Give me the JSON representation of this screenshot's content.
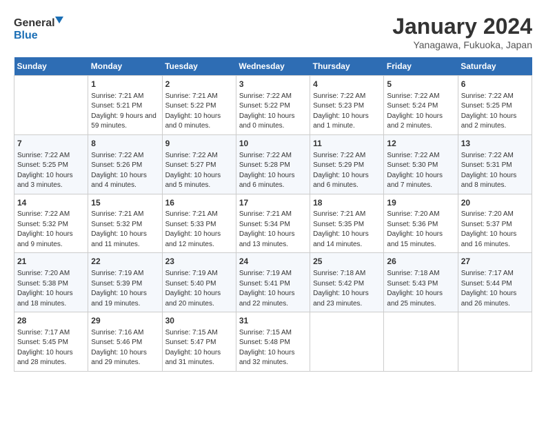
{
  "header": {
    "logo_line1": "General",
    "logo_line2": "Blue",
    "month": "January 2024",
    "location": "Yanagawa, Fukuoka, Japan"
  },
  "days_of_week": [
    "Sunday",
    "Monday",
    "Tuesday",
    "Wednesday",
    "Thursday",
    "Friday",
    "Saturday"
  ],
  "weeks": [
    [
      {
        "day": "",
        "info": ""
      },
      {
        "day": "1",
        "info": "Sunrise: 7:21 AM\nSunset: 5:21 PM\nDaylight: 9 hours\nand 59 minutes."
      },
      {
        "day": "2",
        "info": "Sunrise: 7:21 AM\nSunset: 5:22 PM\nDaylight: 10 hours\nand 0 minutes."
      },
      {
        "day": "3",
        "info": "Sunrise: 7:22 AM\nSunset: 5:22 PM\nDaylight: 10 hours\nand 0 minutes."
      },
      {
        "day": "4",
        "info": "Sunrise: 7:22 AM\nSunset: 5:23 PM\nDaylight: 10 hours\nand 1 minute."
      },
      {
        "day": "5",
        "info": "Sunrise: 7:22 AM\nSunset: 5:24 PM\nDaylight: 10 hours\nand 2 minutes."
      },
      {
        "day": "6",
        "info": "Sunrise: 7:22 AM\nSunset: 5:25 PM\nDaylight: 10 hours\nand 2 minutes."
      }
    ],
    [
      {
        "day": "7",
        "info": "Sunrise: 7:22 AM\nSunset: 5:25 PM\nDaylight: 10 hours\nand 3 minutes."
      },
      {
        "day": "8",
        "info": "Sunrise: 7:22 AM\nSunset: 5:26 PM\nDaylight: 10 hours\nand 4 minutes."
      },
      {
        "day": "9",
        "info": "Sunrise: 7:22 AM\nSunset: 5:27 PM\nDaylight: 10 hours\nand 5 minutes."
      },
      {
        "day": "10",
        "info": "Sunrise: 7:22 AM\nSunset: 5:28 PM\nDaylight: 10 hours\nand 6 minutes."
      },
      {
        "day": "11",
        "info": "Sunrise: 7:22 AM\nSunset: 5:29 PM\nDaylight: 10 hours\nand 6 minutes."
      },
      {
        "day": "12",
        "info": "Sunrise: 7:22 AM\nSunset: 5:30 PM\nDaylight: 10 hours\nand 7 minutes."
      },
      {
        "day": "13",
        "info": "Sunrise: 7:22 AM\nSunset: 5:31 PM\nDaylight: 10 hours\nand 8 minutes."
      }
    ],
    [
      {
        "day": "14",
        "info": "Sunrise: 7:22 AM\nSunset: 5:32 PM\nDaylight: 10 hours\nand 9 minutes."
      },
      {
        "day": "15",
        "info": "Sunrise: 7:21 AM\nSunset: 5:32 PM\nDaylight: 10 hours\nand 11 minutes."
      },
      {
        "day": "16",
        "info": "Sunrise: 7:21 AM\nSunset: 5:33 PM\nDaylight: 10 hours\nand 12 minutes."
      },
      {
        "day": "17",
        "info": "Sunrise: 7:21 AM\nSunset: 5:34 PM\nDaylight: 10 hours\nand 13 minutes."
      },
      {
        "day": "18",
        "info": "Sunrise: 7:21 AM\nSunset: 5:35 PM\nDaylight: 10 hours\nand 14 minutes."
      },
      {
        "day": "19",
        "info": "Sunrise: 7:20 AM\nSunset: 5:36 PM\nDaylight: 10 hours\nand 15 minutes."
      },
      {
        "day": "20",
        "info": "Sunrise: 7:20 AM\nSunset: 5:37 PM\nDaylight: 10 hours\nand 16 minutes."
      }
    ],
    [
      {
        "day": "21",
        "info": "Sunrise: 7:20 AM\nSunset: 5:38 PM\nDaylight: 10 hours\nand 18 minutes."
      },
      {
        "day": "22",
        "info": "Sunrise: 7:19 AM\nSunset: 5:39 PM\nDaylight: 10 hours\nand 19 minutes."
      },
      {
        "day": "23",
        "info": "Sunrise: 7:19 AM\nSunset: 5:40 PM\nDaylight: 10 hours\nand 20 minutes."
      },
      {
        "day": "24",
        "info": "Sunrise: 7:19 AM\nSunset: 5:41 PM\nDaylight: 10 hours\nand 22 minutes."
      },
      {
        "day": "25",
        "info": "Sunrise: 7:18 AM\nSunset: 5:42 PM\nDaylight: 10 hours\nand 23 minutes."
      },
      {
        "day": "26",
        "info": "Sunrise: 7:18 AM\nSunset: 5:43 PM\nDaylight: 10 hours\nand 25 minutes."
      },
      {
        "day": "27",
        "info": "Sunrise: 7:17 AM\nSunset: 5:44 PM\nDaylight: 10 hours\nand 26 minutes."
      }
    ],
    [
      {
        "day": "28",
        "info": "Sunrise: 7:17 AM\nSunset: 5:45 PM\nDaylight: 10 hours\nand 28 minutes."
      },
      {
        "day": "29",
        "info": "Sunrise: 7:16 AM\nSunset: 5:46 PM\nDaylight: 10 hours\nand 29 minutes."
      },
      {
        "day": "30",
        "info": "Sunrise: 7:15 AM\nSunset: 5:47 PM\nDaylight: 10 hours\nand 31 minutes."
      },
      {
        "day": "31",
        "info": "Sunrise: 7:15 AM\nSunset: 5:48 PM\nDaylight: 10 hours\nand 32 minutes."
      },
      {
        "day": "",
        "info": ""
      },
      {
        "day": "",
        "info": ""
      },
      {
        "day": "",
        "info": ""
      }
    ]
  ]
}
